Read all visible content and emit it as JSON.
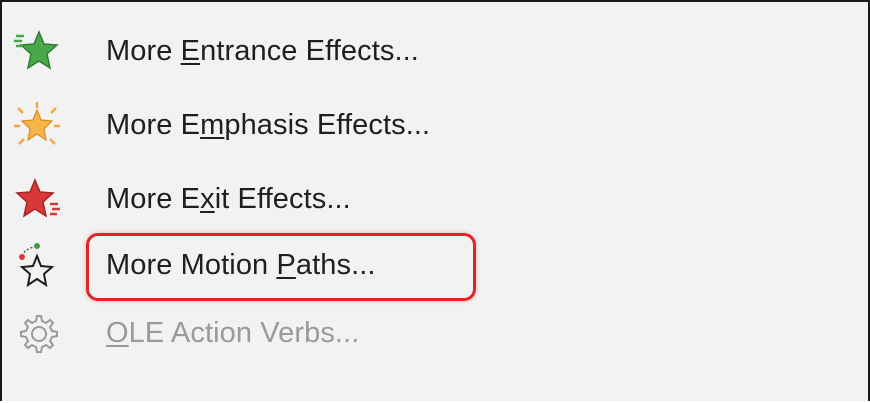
{
  "menu": {
    "items": [
      {
        "pre": "More ",
        "key": "E",
        "post": "ntrance Effects...",
        "icon": "entrance-star-icon",
        "color": "#3f9c3f",
        "enabled": true
      },
      {
        "pre": "More E",
        "key": "m",
        "post": "phasis Effects...",
        "icon": "emphasis-star-icon",
        "color": "#f2a93b",
        "enabled": true
      },
      {
        "pre": "More E",
        "key": "x",
        "post": "it Effects...",
        "icon": "exit-star-icon",
        "color": "#d9383a",
        "enabled": true
      },
      {
        "pre": "More Motion ",
        "key": "P",
        "post": "aths...",
        "icon": "motion-path-star-icon",
        "color": "#1f1f1f",
        "enabled": true,
        "highlighted": true
      },
      {
        "pre": "",
        "key": "O",
        "post": "LE Action Verbs...",
        "icon": "gear-icon",
        "color": "#9a9a9a",
        "enabled": false
      }
    ],
    "highlight_color": "#e0242a"
  }
}
